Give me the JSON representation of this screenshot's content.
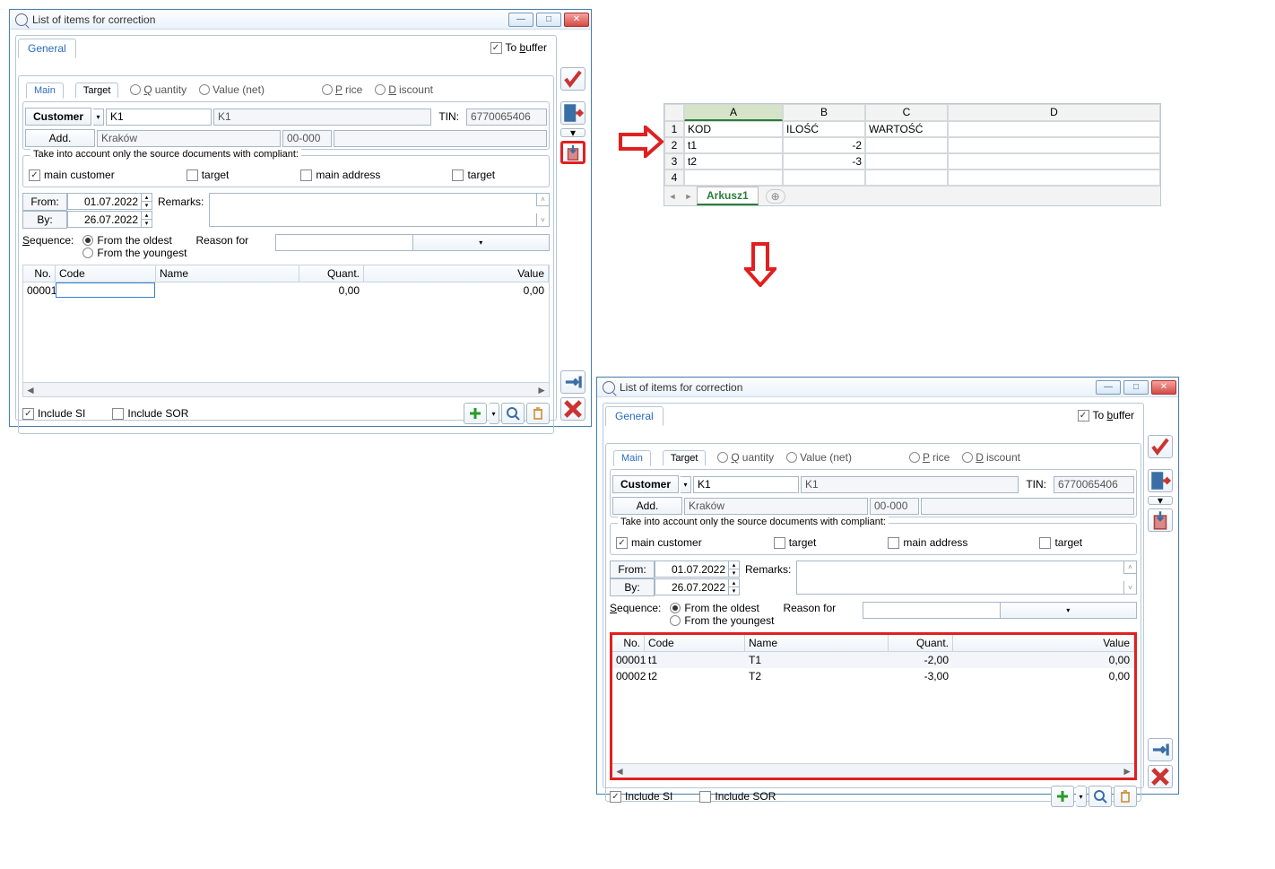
{
  "window": {
    "title": "List of items for correction",
    "tab_general": "General",
    "to_buffer": "To buffer",
    "inner_tabs": {
      "main": "Main",
      "target": "Target"
    },
    "radios": {
      "quantity": "Quantity",
      "value_net": "Value (net)",
      "price": "Price",
      "discount": "Discount"
    },
    "customer": {
      "btn": "Customer",
      "code": "K1",
      "name": "K1",
      "tin_label": "TIN:",
      "tin": "6770065406"
    },
    "address": {
      "btn": "Add.",
      "city": "Kraków",
      "zip": "00-000"
    },
    "compliant_legend": "Take into account only the source documents with compliant:",
    "compliant": {
      "main_customer": "main customer",
      "target1": "target",
      "main_address": "main address",
      "target2": "target"
    },
    "dates": {
      "from_label": "From:",
      "by_label": "By:",
      "from": "01.07.2022",
      "by": "26.07.2022"
    },
    "remarks_label": "Remarks:",
    "sequence_label": "Sequence:",
    "seq_opts": {
      "oldest": "From the oldest",
      "youngest": "From the youngest"
    },
    "reason_label": "Reason for",
    "grid_headers": {
      "no": "No.",
      "code": "Code",
      "name": "Name",
      "quant": "Quant.",
      "value": "Value"
    },
    "grid1_rows": [
      {
        "no": "00001",
        "code": "",
        "name": "",
        "quant": "0,00",
        "value": "0,00"
      }
    ],
    "grid2_rows": [
      {
        "no": "00001",
        "code": "t1",
        "name": "T1",
        "quant": "-2,00",
        "value": "0,00"
      },
      {
        "no": "00002",
        "code": "t2",
        "name": "T2",
        "quant": "-3,00",
        "value": "0,00"
      }
    ],
    "include_si": "Include SI",
    "include_sor": "Include SOR"
  },
  "excel": {
    "cols": [
      "A",
      "B",
      "C",
      "D"
    ],
    "rows": [
      [
        "KOD",
        "ILOŚĆ",
        "WARTOŚĆ",
        ""
      ],
      [
        "t1",
        "-2",
        "",
        ""
      ],
      [
        "t2",
        "-3",
        "",
        ""
      ],
      [
        "",
        "",
        "",
        ""
      ]
    ],
    "tab": "Arkusz1"
  }
}
